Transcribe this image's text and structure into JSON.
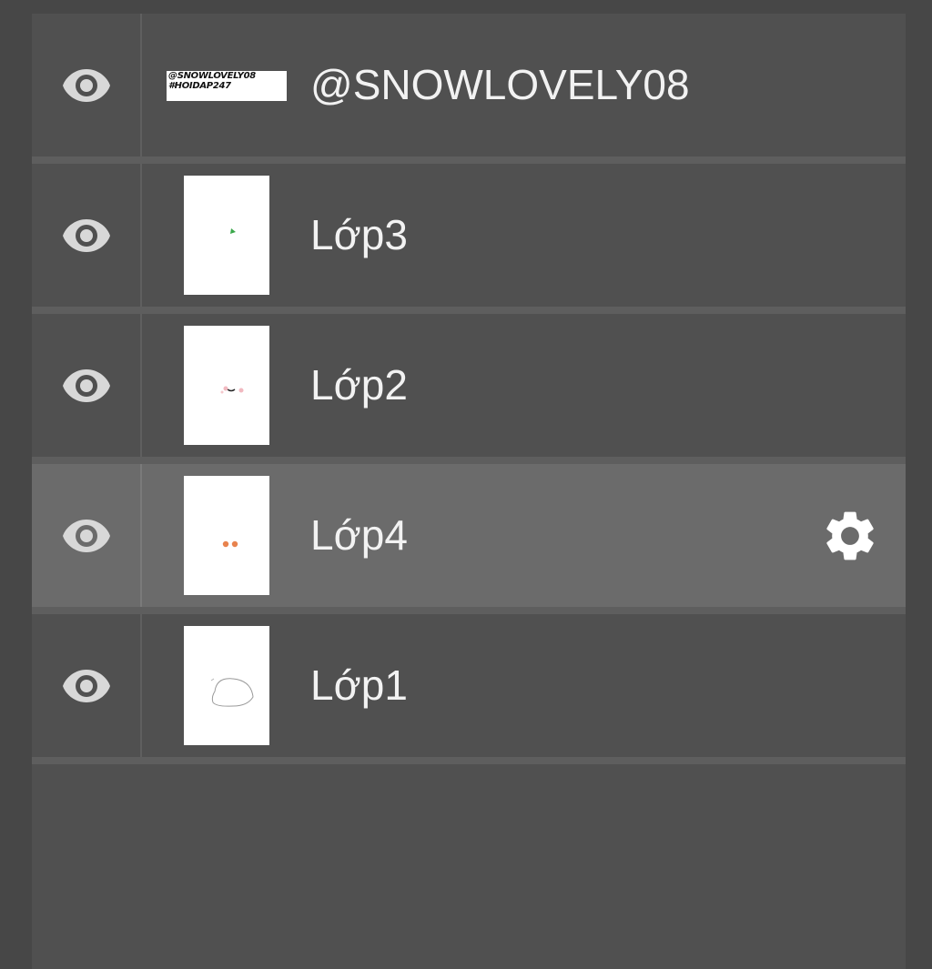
{
  "layers_panel": {
    "layers": [
      {
        "name": "@SNOWLOVELY08",
        "visible": true,
        "selected": false,
        "thumbnail_text": [
          "@SNOWLOVELY08",
          "#HOIDAP247"
        ],
        "eye_icon": "eye-icon"
      },
      {
        "name": "Lớp3",
        "visible": true,
        "selected": false,
        "eye_icon": "eye-icon"
      },
      {
        "name": "Lớp2",
        "visible": true,
        "selected": false,
        "eye_icon": "eye-icon"
      },
      {
        "name": "Lớp4",
        "visible": true,
        "selected": true,
        "eye_icon": "eye-icon",
        "settings_icon": "gear-icon"
      },
      {
        "name": "Lớp1",
        "visible": true,
        "selected": false,
        "eye_icon": "eye-icon"
      }
    ]
  },
  "colors": {
    "background": "#474747",
    "panel": "#505050",
    "selected_row": "#6b6b6b",
    "text": "#f2f2f2",
    "icon": "#d8d8d8"
  }
}
